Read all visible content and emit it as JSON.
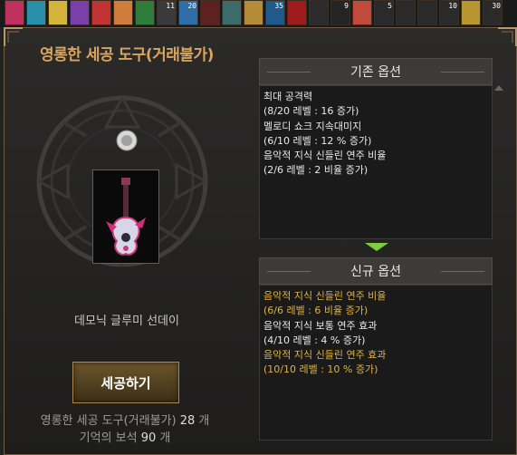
{
  "inventory_strip": [
    {
      "count": "",
      "color": "#c0305e"
    },
    {
      "count": "",
      "color": "#2a8fa8"
    },
    {
      "count": "",
      "color": "#d4b43a"
    },
    {
      "count": "",
      "color": "#7a3fa8"
    },
    {
      "count": "",
      "color": "#c23434"
    },
    {
      "count": "",
      "color": "#d07c3a"
    },
    {
      "count": "",
      "color": "#2f7d3b"
    },
    {
      "count": "11",
      "color": "#3a3a3a"
    },
    {
      "count": "20",
      "color": "#2f6ea8"
    },
    {
      "count": "",
      "color": "#5f2020"
    },
    {
      "count": "",
      "color": "#3c6b6a"
    },
    {
      "count": "",
      "color": "#b68b38"
    },
    {
      "count": "35",
      "color": "#1e5a8a"
    },
    {
      "count": "",
      "color": "#a01c1c"
    },
    {
      "count": "",
      "color": "#2c2c2c"
    },
    {
      "count": "9",
      "color": "#242424"
    },
    {
      "count": "",
      "color": "#c24a3a"
    },
    {
      "count": "5",
      "color": "#2a2a2a"
    },
    {
      "count": "",
      "color": "#2a2a2a"
    },
    {
      "count": "",
      "color": "#2a2a2a"
    },
    {
      "count": "10",
      "color": "#2a2a2a"
    },
    {
      "count": "",
      "color": "#b8962f"
    },
    {
      "count": "30",
      "color": "#2a2a2a"
    }
  ],
  "title": "영롱한 세공 도구(거래불가)",
  "item_name": "데모닉 글루미 선데이",
  "craft_button": "세공하기",
  "costs": [
    {
      "label": "영롱한 세공 도구(거래불가)",
      "num": "28",
      "unit": "개"
    },
    {
      "label": "기억의 보석",
      "num": "90",
      "unit": "개"
    }
  ],
  "existing_options": {
    "header": "기존 옵션",
    "lines": [
      {
        "text": "최대 공격력",
        "color": "white"
      },
      {
        "text": "(8/20 레벨 : 16 증가)",
        "color": "white"
      },
      {
        "text": "멜로디 쇼크 지속대미지",
        "color": "white"
      },
      {
        "text": "(6/10 레벨 : 12 % 증가)",
        "color": "white"
      },
      {
        "text": "음악적 지식 신들린 연주 비율",
        "color": "white"
      },
      {
        "text": "(2/6 레벨 : 2 비율 증가)",
        "color": "white"
      }
    ]
  },
  "new_options": {
    "header": "신규 옵션",
    "lines": [
      {
        "text": "음악적 지식 신들린 연주 비율",
        "color": "yellow"
      },
      {
        "text": "(6/6 레벨 : 6 비율 증가)",
        "color": "yellow"
      },
      {
        "text": "음악적 지식 보통 연주 효과",
        "color": "white"
      },
      {
        "text": "(4/10 레벨 : 4 % 증가)",
        "color": "white"
      },
      {
        "text": "음악적 지식 신들린 연주 효과",
        "color": "yellow"
      },
      {
        "text": "(10/10 레벨 : 10 % 증가)",
        "color": "yellow"
      }
    ]
  },
  "colors": {
    "title_gold": "#d7a560",
    "option_yellow": "#e0b23f",
    "arrow_green": "#7fcc3e"
  }
}
